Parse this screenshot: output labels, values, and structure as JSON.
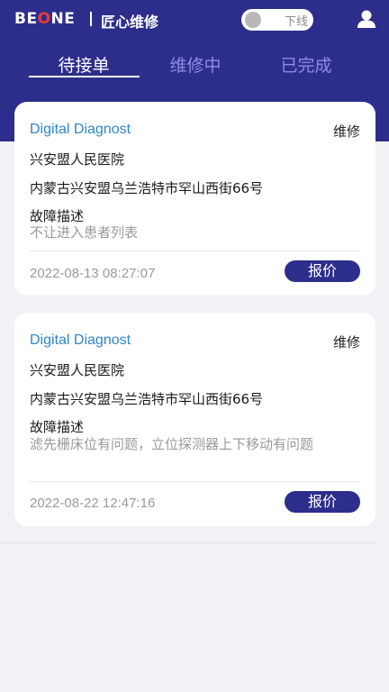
{
  "header": {
    "logo_pre": "BE",
    "logo_o": "O",
    "logo_post": "NE",
    "subtitle": "匠心维修",
    "status_toggle_label": "下线",
    "status_toggle_on": false,
    "icon": "user-icon"
  },
  "tabs": [
    {
      "label": "待接单",
      "active": true
    },
    {
      "label": "维修中",
      "active": false
    },
    {
      "label": "已完成",
      "active": false
    }
  ],
  "orders": [
    {
      "device": "Digital Diagnost",
      "type": "维修",
      "hospital": "兴安盟人民医院",
      "address": "内蒙古兴安盟乌兰浩特市罕山西街66号",
      "fault_label": "故障描述",
      "fault": "不让进入患者列表",
      "time": "2022-08-13 08:27:07",
      "action": "报价"
    },
    {
      "device": "Digital Diagnost",
      "type": "维修",
      "hospital": "兴安盟人民医院",
      "address": "内蒙古兴安盟乌兰浩特市罕山西街66号",
      "fault_label": "故障描述",
      "fault": "滤先栅床位有问题，立位探测器上下移动有问题",
      "time": "2022-08-22 12:47:16",
      "action": "报价"
    }
  ],
  "colors": {
    "primary": "#2d2d8c",
    "accent_title": "#2f86c8",
    "background": "#f2f2f6"
  }
}
